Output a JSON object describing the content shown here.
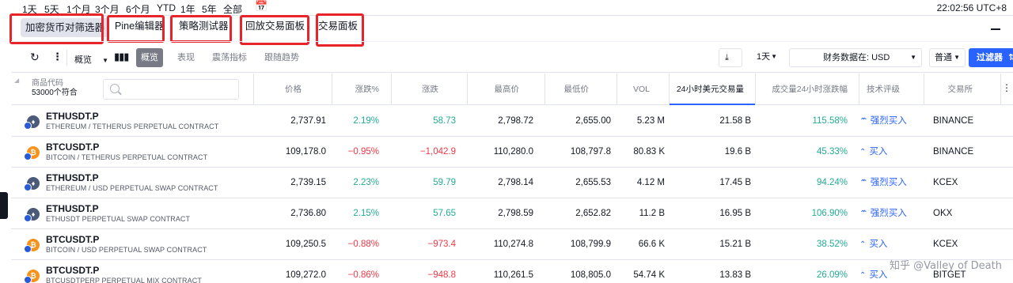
{
  "range_bar": {
    "items": [
      "1天",
      "5天",
      "1个月",
      "3个月",
      "6个月",
      "YTD",
      "1年",
      "5年",
      "全部"
    ],
    "clock": "22:02:56 UTC+8"
  },
  "tabs": [
    {
      "label": "加密货币对筛选器",
      "active": true
    },
    {
      "label": "Pine编辑器",
      "active": false
    },
    {
      "label": "策略测试器",
      "active": false
    },
    {
      "label": "回放交易面板",
      "active": false
    },
    {
      "label": "交易面板",
      "active": false
    }
  ],
  "toolbar": {
    "view_select": "概览",
    "tab_buttons": [
      {
        "label": "概览",
        "active": true
      },
      {
        "label": "表现",
        "active": false
      },
      {
        "label": "震荡指标",
        "active": false
      },
      {
        "label": "跟随趋势",
        "active": false
      }
    ],
    "interval": "1天",
    "currency_select": "财务数据在: USD",
    "mode_select": "普通",
    "filter_label": "过滤器"
  },
  "table": {
    "symbol_header": "商品代码",
    "symbol_count": "53000个符合",
    "search_placeholder": "",
    "columns": [
      "价格",
      "涨跌%",
      "涨跌",
      "最高价",
      "最低价",
      "VOL",
      "24小时美元交易量",
      "成交量24小时涨跌幅",
      "技术评级",
      "交易所"
    ],
    "rows": [
      {
        "ticker": "ETHUSDT.P",
        "desc": "ETHEREUM / TETHERUS PERPETUAL CONTRACT",
        "coin": "eth",
        "price": "2,737.91",
        "chg_pct": "2.19%",
        "chg": "58.73",
        "high": "2,798.72",
        "low": "2,655.00",
        "vol": "5.23 M",
        "vol24": "21.58 B",
        "vol24chg": "115.58%",
        "rating": "强烈买入",
        "rating_icon": "double-chevron-up-icon",
        "exchange": "BINANCE",
        "dir": "pos"
      },
      {
        "ticker": "BTCUSDT.P",
        "desc": "BITCOIN / TETHERUS PERPETUAL CONTRACT",
        "coin": "btc",
        "price": "109,178.0",
        "chg_pct": "−0.95%",
        "chg": "−1,042.9",
        "high": "110,280.0",
        "low": "108,797.8",
        "vol": "80.83 K",
        "vol24": "19.6 B",
        "vol24chg": "45.33%",
        "rating": "买入",
        "rating_icon": "chevron-up-icon",
        "exchange": "BINANCE",
        "dir": "neg"
      },
      {
        "ticker": "ETHUSDT.P",
        "desc": "ETHEREUM / USD PERPETUAL SWAP CONTRACT",
        "coin": "eth",
        "price": "2,739.15",
        "chg_pct": "2.23%",
        "chg": "59.79",
        "high": "2,798.14",
        "low": "2,655.53",
        "vol": "4.12 M",
        "vol24": "17.45 B",
        "vol24chg": "94.24%",
        "rating": "强烈买入",
        "rating_icon": "double-chevron-up-icon",
        "exchange": "KCEX",
        "dir": "pos"
      },
      {
        "ticker": "ETHUSDT.P",
        "desc": "ETHUSDT PERPETUAL SWAP CONTRACT",
        "coin": "eth",
        "price": "2,736.80",
        "chg_pct": "2.15%",
        "chg": "57.65",
        "high": "2,798.59",
        "low": "2,652.82",
        "vol": "11.2 B",
        "vol24": "16.95 B",
        "vol24chg": "106.90%",
        "rating": "强烈买入",
        "rating_icon": "double-chevron-up-icon",
        "exchange": "OKX",
        "dir": "pos"
      },
      {
        "ticker": "BTCUSDT.P",
        "desc": "BITCOIN / USD PERPETUAL SWAP CONTRACT",
        "coin": "btc",
        "price": "109,250.5",
        "chg_pct": "−0.88%",
        "chg": "−973.4",
        "high": "110,274.8",
        "low": "108,799.9",
        "vol": "66.6 K",
        "vol24": "15.21 B",
        "vol24chg": "38.52%",
        "rating": "买入",
        "rating_icon": "chevron-up-icon",
        "exchange": "KCEX",
        "dir": "neg"
      },
      {
        "ticker": "BTCUSDT.P",
        "desc": "BTCUSDTPERP PERPETUAL MIX CONTRACT",
        "coin": "btc",
        "price": "109,272.0",
        "chg_pct": "−0.86%",
        "chg": "−948.8",
        "high": "110,261.5",
        "low": "108,805.0",
        "vol": "54.74 K",
        "vol24": "13.83 B",
        "vol24chg": "26.09%",
        "rating": "买入",
        "rating_icon": "chevron-up-icon",
        "exchange": "BITGET",
        "dir": "neg"
      }
    ]
  },
  "watermark": "知乎 @Valley of Death",
  "colors": {
    "accent": "#2962ff",
    "positive": "#22ab94",
    "negative": "#f23645",
    "highlight_box": "#e8232a"
  }
}
